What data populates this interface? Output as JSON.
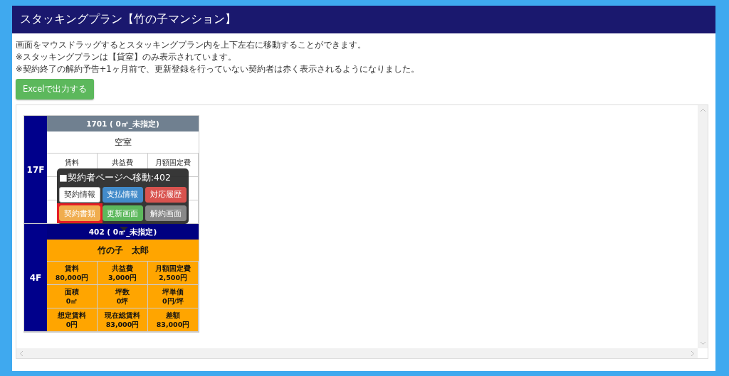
{
  "title": "スタッキングプラン【竹の子マンション】",
  "notes": [
    "画面をマウスドラッグするとスタッキングプラン内を上下左右に移動することができます。",
    "※スタッキングプランは【貸室】のみ表示されています。",
    "※契約終了の解約予告+1ヶ月前で、更新登録を行っていない契約者は赤く表示されるようになりました。"
  ],
  "export_button": "Excelで出力する",
  "floors": [
    {
      "label": "17F",
      "room": {
        "header": "1701 ( 0㎡_未指定)",
        "kind": "vacant",
        "tenant": "空室",
        "cells": [
          {
            "label": "賃料"
          },
          {
            "label": "共益費"
          },
          {
            "label": "月額固定費"
          }
        ]
      }
    },
    {
      "label": "4F",
      "room": {
        "header": "402 ( 0㎡_未指定)",
        "kind": "occupied",
        "tenant": "竹の子　太郎",
        "cells": [
          {
            "label": "賃料",
            "value": "80,000円"
          },
          {
            "label": "共益費",
            "value": "3,000円"
          },
          {
            "label": "月額固定費",
            "value": "2,500円"
          },
          {
            "label": "面積",
            "value": "0㎡"
          },
          {
            "label": "坪数",
            "value": "0坪"
          },
          {
            "label": "坪単価",
            "value": "0円/坪"
          },
          {
            "label": "想定賃料",
            "value": "0円"
          },
          {
            "label": "現在総賃料",
            "value": "83,000円"
          },
          {
            "label": "差額",
            "value": "83,000円"
          }
        ]
      }
    }
  ],
  "popover": {
    "title": "■契約者ページへ移動:402",
    "buttons": [
      {
        "label": "契約情報",
        "kind": "default",
        "highlighted": false
      },
      {
        "label": "支払情報",
        "kind": "primary",
        "highlighted": false
      },
      {
        "label": "対応履歴",
        "kind": "danger",
        "highlighted": false
      },
      {
        "label": "契約書類",
        "kind": "warning",
        "highlighted": true
      },
      {
        "label": "更新画面",
        "kind": "success",
        "highlighted": false
      },
      {
        "label": "解約画面",
        "kind": "secondary",
        "highlighted": false
      }
    ]
  }
}
